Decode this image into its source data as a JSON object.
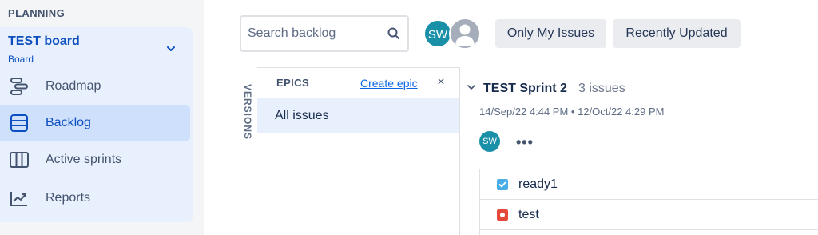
{
  "sidebar": {
    "section_title": "PLANNING",
    "board": {
      "name": "TEST board",
      "type": "Board"
    },
    "items": [
      {
        "label": "Roadmap",
        "icon": "roadmap-icon",
        "active": false
      },
      {
        "label": "Backlog",
        "icon": "backlog-icon",
        "active": true
      },
      {
        "label": "Active sprints",
        "icon": "board-columns-icon",
        "active": false
      },
      {
        "label": "Reports",
        "icon": "reports-chart-icon",
        "active": false
      }
    ]
  },
  "toolbar": {
    "search_placeholder": "Search backlog",
    "avatar_initials": "SW",
    "filters": [
      "Only My Issues",
      "Recently Updated"
    ]
  },
  "versions_label": "VERSIONS",
  "epics": {
    "title": "EPICS",
    "create_label": "Create epic",
    "close_symbol": "×",
    "all_issues_label": "All issues"
  },
  "sprint": {
    "name": "TEST Sprint 2",
    "count_text": "3 issues",
    "dates": "14/Sep/22 4:44 PM  •  12/Oct/22 4:29 PM",
    "assignee_initials": "SW",
    "more_symbol": "•••",
    "issues": [
      {
        "title": "ready1",
        "type": "task",
        "color": "#4bade8"
      },
      {
        "title": "test",
        "type": "bug",
        "color": "#e5493a"
      }
    ]
  },
  "colors": {
    "accent": "#0c4fbf",
    "nav_bg": "#e9f0fd",
    "active_bg": "#cfe0fc",
    "avatar": "#1a8fa8"
  }
}
